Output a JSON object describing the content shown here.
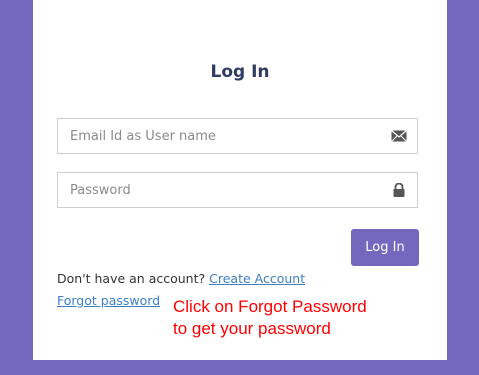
{
  "login_form": {
    "title": "Log In",
    "email_placeholder": "Email Id as User name",
    "password_placeholder": "Password",
    "login_button_label": "Log In",
    "signup_prompt": "Don't have an account?",
    "create_account_link": "Create Account",
    "forgot_password_link": "Forgot password",
    "email_icon": "envelope-icon",
    "password_icon": "lock-icon"
  },
  "annotation": {
    "line1": "Click on Forgot Password",
    "line2": "to get your password",
    "color": "#ff0000"
  },
  "colors": {
    "background": "#7368bd",
    "card": "#ffffff",
    "title": "#2e3b63",
    "link": "#3b7fc4",
    "button": "#7368bd"
  }
}
